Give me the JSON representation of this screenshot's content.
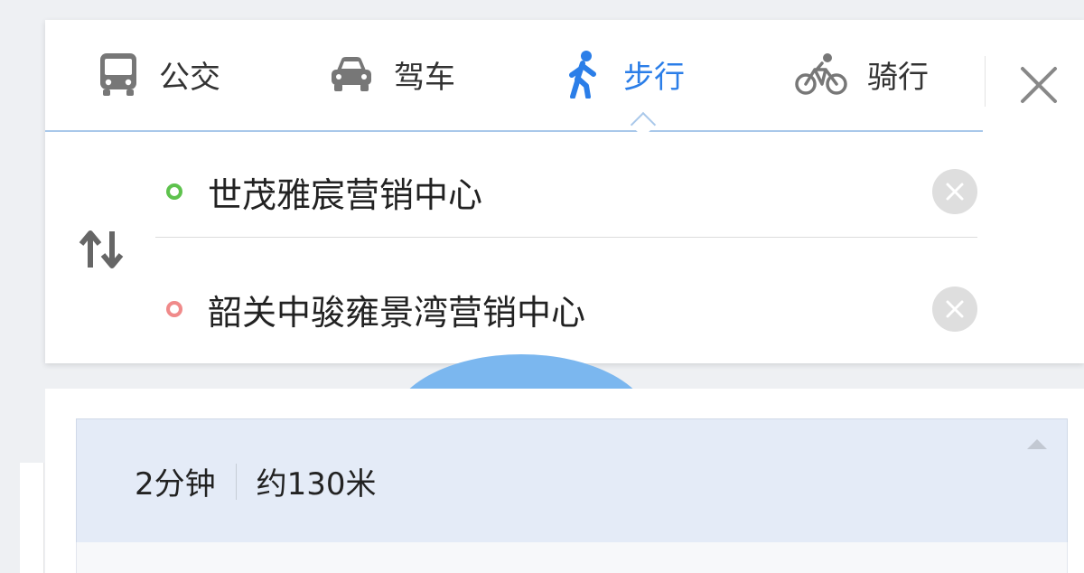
{
  "tabs": [
    {
      "label": "公交",
      "icon": "bus-icon",
      "active": false
    },
    {
      "label": "驾车",
      "icon": "car-icon",
      "active": false
    },
    {
      "label": "步行",
      "icon": "walk-icon",
      "active": true
    },
    {
      "label": "骑行",
      "icon": "bike-icon",
      "active": false
    }
  ],
  "route": {
    "start": "世茂雅宸营销中心",
    "end": "韶关中骏雍景湾营销中心"
  },
  "result": {
    "duration": "2分钟",
    "distance": "约130米"
  },
  "colors": {
    "accent": "#2b7ee8",
    "start_dot": "#5ec24d",
    "end_dot": "#f08a8a",
    "result_bg": "#e4ebf7"
  }
}
